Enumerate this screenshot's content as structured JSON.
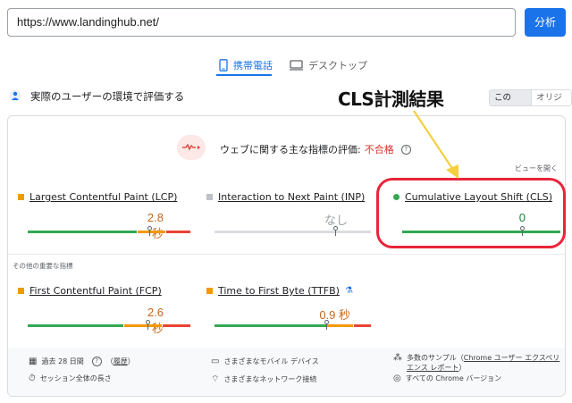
{
  "search": {
    "url": "https://www.landinghub.net/",
    "analyze_label": "分析"
  },
  "tabs": {
    "mobile": "携帯電話",
    "desktop": "デスクトップ"
  },
  "field_data": {
    "header": "実際のユーザーの環境で評価する",
    "toggle_this_url": "この URL",
    "toggle_origin": "オリジン"
  },
  "annotation": {
    "label": "CLS計測結果"
  },
  "assessment": {
    "prefix": "ウェブに関する主な指標の評価: ",
    "result": "不合格",
    "expand": "ビューを開く"
  },
  "core_metrics": [
    {
      "name": "Largest Contentful Paint (LCP)",
      "value": "2.8 秒",
      "status": "orange",
      "marker": 0.66
    },
    {
      "name": "Interaction to Next Paint (INP)",
      "value": "なし",
      "status": "gray",
      "marker": 0.78
    },
    {
      "name": "Cumulative Layout Shift (CLS)",
      "value": "0",
      "status": "green",
      "marker": 0.7
    }
  ],
  "other_metrics_label": "その他の重要な指標",
  "other_metrics": [
    {
      "name": "First Contentful Paint (FCP)",
      "value": "2.6 秒",
      "status": "orange",
      "marker": 0.73
    },
    {
      "name": "Time to First Byte (TTFB)",
      "value": "0.9 秒",
      "status": "orange",
      "marker": 0.7
    }
  ],
  "footer": {
    "period": "過去 28 日間",
    "history": "履歴",
    "session": "セッション全体の長さ",
    "devices": "さまざまなモバイル デバイス",
    "network": "さまざまなネットワーク接続",
    "samples_prefix": "多数のサンプル（",
    "samples_link": "Chrome ユーザー エクスペリエンス レポート",
    "samples_suffix": "）",
    "chrome": "すべての Chrome バージョン"
  },
  "colors": {
    "good": "#34a853",
    "needs_improvement": "#f29900",
    "poor": "#ea4335",
    "accent": "#1a73e8",
    "highlight": "#e8253a",
    "arrow": "#f4d03f"
  }
}
